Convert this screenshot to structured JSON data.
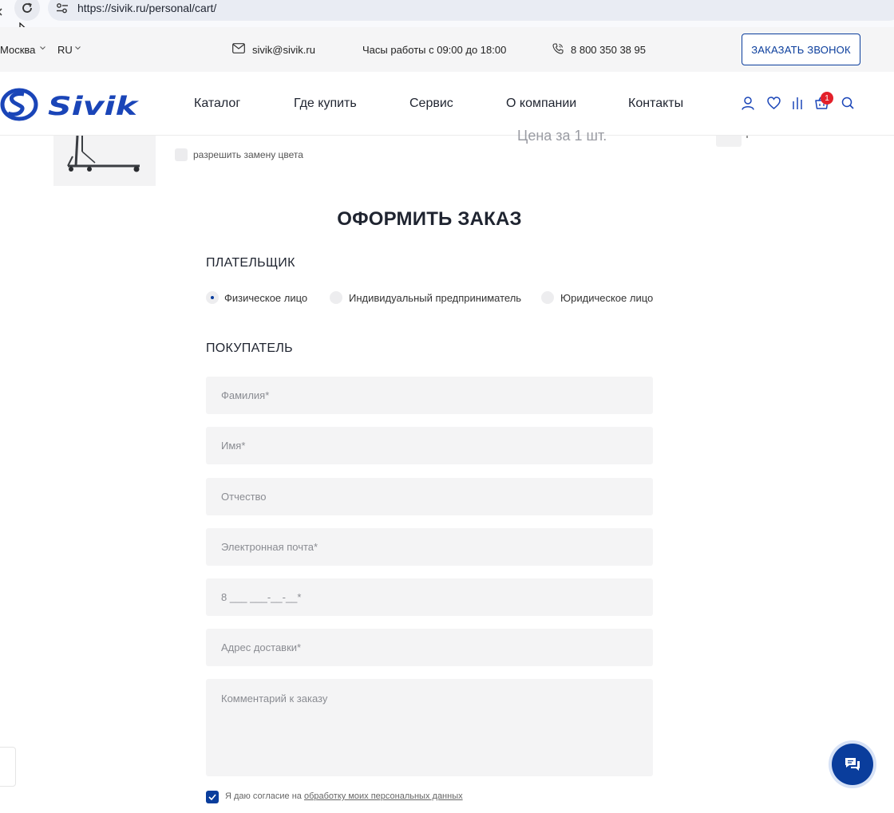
{
  "browser": {
    "url": "https://sivik.ru/personal/cart/"
  },
  "topbar": {
    "city": "Москва",
    "language": "RU",
    "email": "sivik@sivik.ru",
    "hours": "Часы работы с 09:00 до 18:00",
    "phone": "8 800 350 38 95",
    "callback_label": "ЗАКАЗАТЬ ЗВОНОК"
  },
  "header": {
    "logo_text": "Sivik",
    "nav": [
      "Каталог",
      "Где купить",
      "Сервис",
      "О компании",
      "Контакты"
    ],
    "cart_count": "1"
  },
  "product": {
    "color_replace_label": "разрешить замену цвета",
    "price_caption": "Цена за 1 шт."
  },
  "order": {
    "title": "ОФОРМИТЬ ЗАКАЗ",
    "payer_title": "ПЛАТЕЛЬЩИК",
    "payer_options": [
      "Физическое лицо",
      "Индивидуальный предприниматель",
      "Юридическое лицо"
    ],
    "payer_selected": "Физическое лицо",
    "buyer_title": "ПОКУПАТЕЛЬ",
    "fields": {
      "last_name": "Фамилия*",
      "first_name": "Имя*",
      "middle_name": "Отчество",
      "email": "Электронная почта*",
      "phone": "8 ___ ___-__-__*",
      "address": "Адрес доставки*",
      "comment": "Комментарий к заказу"
    },
    "consent_text": "Я даю согласие на ",
    "consent_link": "обработку моих персональных данных"
  },
  "colors": {
    "brand_blue": "#0a3d9c",
    "badge_red": "#e3202a"
  }
}
